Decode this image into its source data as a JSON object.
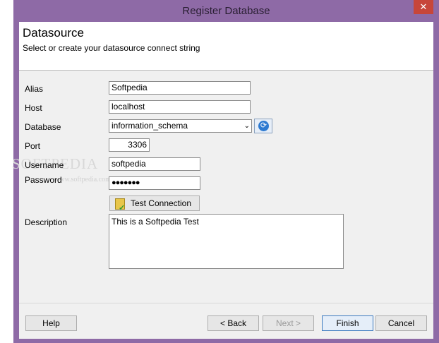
{
  "window": {
    "title": "Register Database",
    "close_glyph": "✕"
  },
  "header": {
    "title": "Datasource",
    "subtitle": "Select or create your datasource connect string"
  },
  "form": {
    "alias_label": "Alias",
    "alias_value": "Softpedia",
    "host_label": "Host",
    "host_value": "localhost",
    "database_label": "Database",
    "database_value": "information_schema",
    "port_label": "Port",
    "port_value": "3306",
    "username_label": "Username",
    "username_value": "softpedia",
    "password_label": "Password",
    "password_value": "●●●●●●●",
    "test_connection_label": "Test Connection",
    "description_label": "Description",
    "description_value": "This is a Softpedia Test"
  },
  "watermark": {
    "text": "SOFTPEDIA",
    "sub": "www.softpedia.com"
  },
  "buttons": {
    "help": "Help",
    "back": "< Back",
    "next": "Next >",
    "finish": "Finish",
    "cancel": "Cancel"
  },
  "icons": {
    "close": "close-icon",
    "refresh": "refresh-icon",
    "test": "test-connection-icon",
    "dropdown": "chevron-down-icon"
  }
}
